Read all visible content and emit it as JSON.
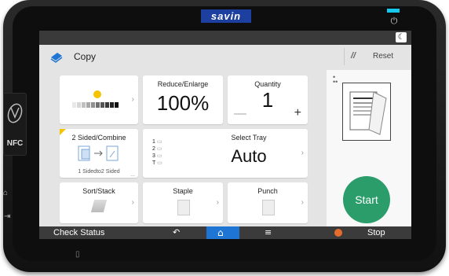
{
  "device": {
    "brand": "savin"
  },
  "header": {
    "app_title": "Copy",
    "reset_label": "Reset"
  },
  "nfc": {
    "label": "NFC"
  },
  "tiles": {
    "density": {
      "chevron": "›"
    },
    "reduce_enlarge": {
      "title": "Reduce/Enlarge",
      "value": "100%"
    },
    "quantity": {
      "title": "Quantity",
      "value": "1",
      "minus": "—",
      "plus": "+"
    },
    "sided": {
      "title": "2 Sided/Combine",
      "setting": "1 Sidedto2 Sided"
    },
    "select_tray": {
      "title": "Select Tray",
      "value": "Auto",
      "trays": [
        "1",
        "2",
        "3",
        "T"
      ]
    },
    "sort_stack": {
      "title": "Sort/Stack"
    },
    "staple": {
      "title": "Staple"
    },
    "punch": {
      "title": "Punch"
    }
  },
  "start": {
    "label": "Start"
  },
  "bottom_bar": {
    "check_status": "Check Status",
    "stop": "Stop"
  },
  "colors": {
    "accent_blue": "#1e75d4",
    "start_green": "#2a9d6a",
    "stop_orange": "#e56c2c",
    "brand_blue": "#1c3fa0"
  },
  "icons": [
    "copy-icon",
    "reset-icon",
    "power-icon",
    "moon-icon",
    "back-icon",
    "home-icon",
    "menu-icon",
    "stop-icon",
    "nfc-icon",
    "tray-icon",
    "scanner-icon"
  ]
}
